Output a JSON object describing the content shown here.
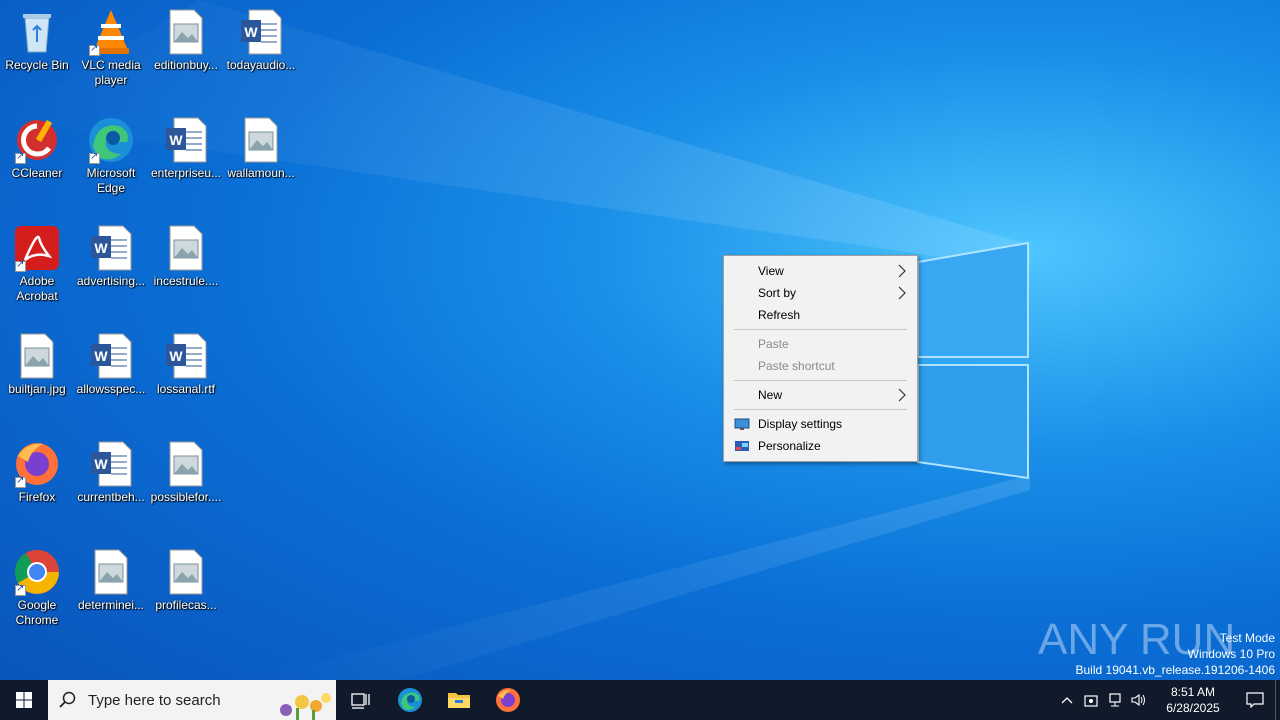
{
  "desktop": {
    "icons": [
      {
        "label": "Recycle Bin",
        "type": "recycle-bin"
      },
      {
        "label": "VLC media player",
        "type": "vlc"
      },
      {
        "label": "editionbuy...",
        "type": "image-file"
      },
      {
        "label": "todayaudio...",
        "type": "word-file"
      },
      {
        "label": "CCleaner",
        "type": "ccleaner"
      },
      {
        "label": "Microsoft Edge",
        "type": "edge"
      },
      {
        "label": "enterpriseu...",
        "type": "word-file"
      },
      {
        "label": "wallamoun...",
        "type": "image-file"
      },
      {
        "label": "Adobe Acrobat",
        "type": "acrobat"
      },
      {
        "label": "advertising...",
        "type": "word-file"
      },
      {
        "label": "incestrule....",
        "type": "image-file"
      },
      {
        "label": "builtjan.jpg",
        "type": "image-file"
      },
      {
        "label": "allowsspec...",
        "type": "word-file"
      },
      {
        "label": "lossanal.rtf",
        "type": "word-file"
      },
      {
        "label": "Firefox",
        "type": "firefox"
      },
      {
        "label": "currentbeh...",
        "type": "word-file"
      },
      {
        "label": "possiblefor....",
        "type": "image-file"
      },
      {
        "label": "Google Chrome",
        "type": "chrome"
      },
      {
        "label": "determinei...",
        "type": "image-file"
      },
      {
        "label": "profilecas...",
        "type": "image-file"
      }
    ]
  },
  "context_menu": {
    "view": "View",
    "sort_by": "Sort by",
    "refresh": "Refresh",
    "paste": "Paste",
    "paste_shortcut": "Paste shortcut",
    "new": "New",
    "display_settings": "Display settings",
    "personalize": "Personalize"
  },
  "watermark": {
    "line1": "Test Mode",
    "line2": "Windows 10 Pro",
    "line3": "Build 19041.vb_release.191206-1406",
    "logo_text": "ANY RUN"
  },
  "taskbar": {
    "search_placeholder": "Type here to search",
    "time": "8:51 AM",
    "date": "6/28/2025",
    "pinned": [
      "task-view-icon",
      "edge-icon",
      "file-explorer-icon",
      "firefox-icon"
    ]
  },
  "colors": {
    "taskbar": "#101a2a",
    "menu_bg": "#f2f2f2",
    "wallpaper": "#0a6fd6"
  }
}
